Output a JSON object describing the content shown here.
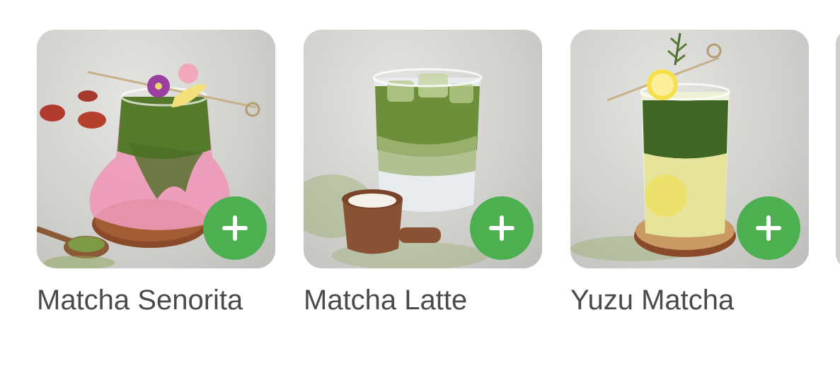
{
  "products": [
    {
      "name": "Matcha Senorita",
      "add_icon": "plus-icon"
    },
    {
      "name": "Matcha Latte",
      "add_icon": "plus-icon"
    },
    {
      "name": "Yuzu Matcha",
      "add_icon": "plus-icon"
    }
  ],
  "colors": {
    "add_button": "#4caf50",
    "title_text": "#4a4a4a"
  }
}
